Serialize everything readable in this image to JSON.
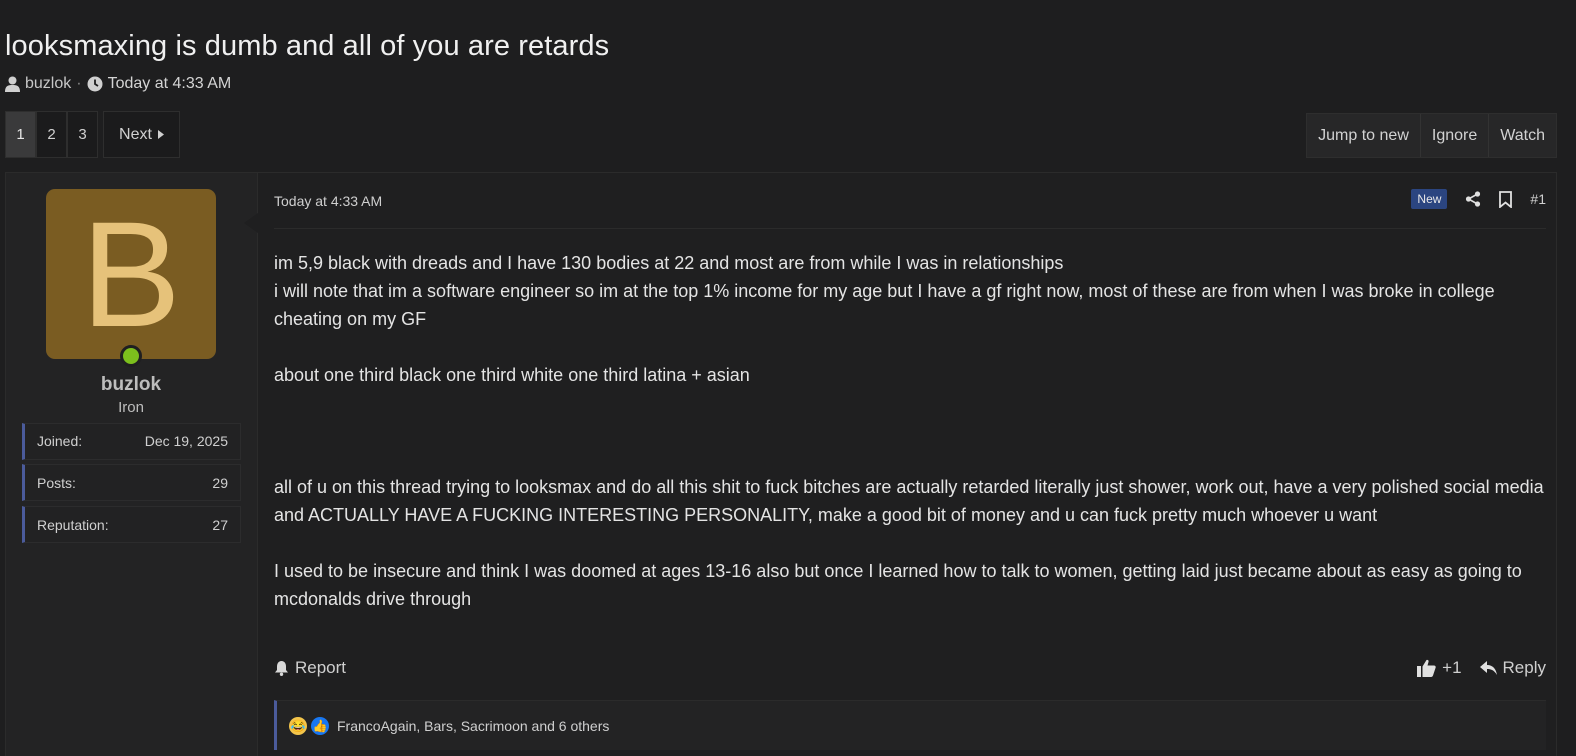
{
  "thread": {
    "title": "looksmaxing is dumb and all of you are retards",
    "author": "buzlok",
    "separator": "·",
    "time": "Today at 4:33 AM"
  },
  "pagination": {
    "pages": [
      "1",
      "2",
      "3"
    ],
    "current": "1",
    "next_label": "Next"
  },
  "thread_actions": {
    "jump_to_new": "Jump to new",
    "ignore": "Ignore",
    "watch": "Watch"
  },
  "user": {
    "avatar_letter": "B",
    "name": "buzlok",
    "title": "Iron",
    "stats": [
      {
        "label": "Joined:",
        "value": "Dec 19, 2025"
      },
      {
        "label": "Posts:",
        "value": "29"
      },
      {
        "label": "Reputation:",
        "value": "27"
      }
    ],
    "online": true,
    "colors": {
      "avatar_bg": "#7a5c22",
      "avatar_fg": "#e6c27a",
      "online": "#7cbf1d"
    }
  },
  "post": {
    "date": "Today at 4:33 AM",
    "new_badge": "New",
    "number": "#1",
    "body": "im 5,9 black with dreads and I have 130 bodies at 22 and most are from while I was in relationships\ni will note that im a software engineer so im at the top 1% income for my age but I have a gf right now, most of these are from when I was broke in college cheating on my GF\n\nabout one third black one third white one third latina + asian\n\n\n\nall of u on this thread trying to looksmax and do all this shit to fuck bitches are actually retarded literally just shower, work out, have a very polished social media and ACTUALLY HAVE A FUCKING INTERESTING PERSONALITY, make a good bit of money and u can fuck pretty much whoever u want\n\nI used to be insecure and think I was doomed at ages 13-16 also but once I learned how to talk to women, getting laid just became about as easy as going to mcdonalds drive through",
    "report_label": "Report",
    "like_label": "+1",
    "reply_label": "Reply",
    "reactions_text": "FrancoAgain, Bars, Sacrimoon and 6 others",
    "reaction_icons": [
      "laugh-emoji",
      "like-emoji"
    ]
  }
}
